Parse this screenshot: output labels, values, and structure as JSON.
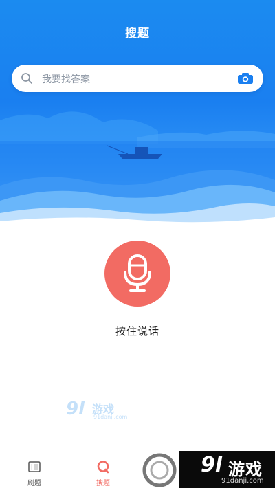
{
  "header": {
    "title": "搜题"
  },
  "search": {
    "placeholder": "我要找答案",
    "icon": "search-icon",
    "camera_icon": "camera-icon"
  },
  "voice": {
    "label": "按住说话",
    "icon": "microphone-icon",
    "color": "#f26b63"
  },
  "tabs": [
    {
      "label": "刷题",
      "icon": "list-icon",
      "active": false
    },
    {
      "label": "搜题",
      "icon": "search-tab-icon",
      "active": true
    }
  ],
  "watermark": {
    "logo": "9l",
    "name": "游戏",
    "url": "91danji.com"
  },
  "banner": {
    "logo": "9l",
    "name": "游戏",
    "url": "91danji.com"
  },
  "colors": {
    "primary": "#1a7ff0",
    "accent": "#f26b63"
  }
}
